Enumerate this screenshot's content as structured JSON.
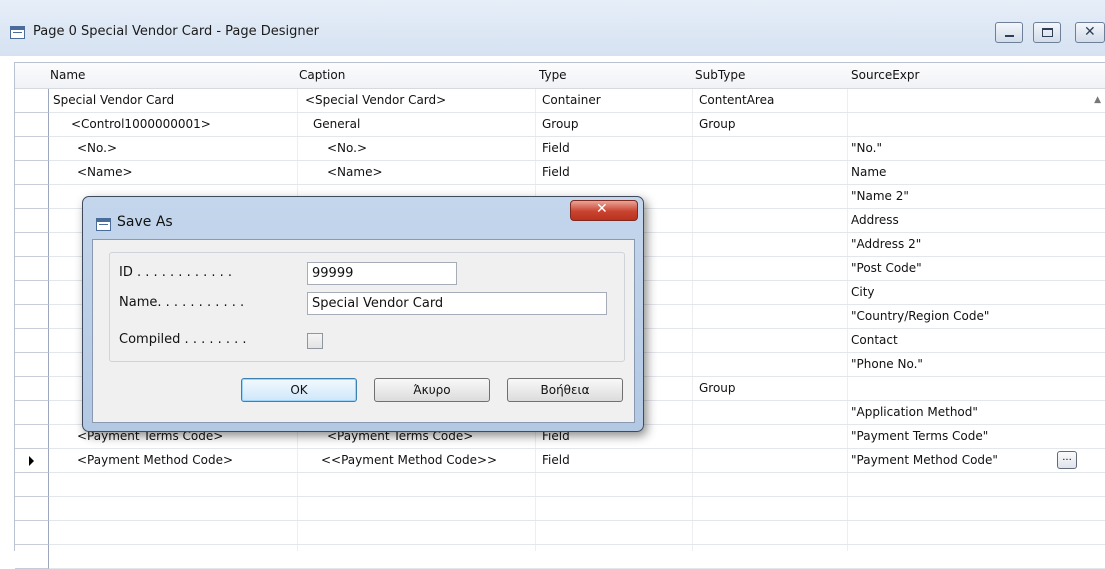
{
  "window": {
    "title": "Page 0 Special Vendor Card - Page Designer"
  },
  "grid": {
    "columns": [
      "Name",
      "Caption",
      "Type",
      "SubType",
      "SourceExpr"
    ],
    "rows": [
      {
        "name": "Special Vendor Card",
        "caption": "<Special Vendor Card>",
        "type": "Container",
        "subtype": "ContentArea",
        "source": ""
      },
      {
        "name": "<Control1000000001>",
        "caption": "General",
        "type": "Group",
        "subtype": "Group",
        "source": ""
      },
      {
        "name": "<No.>",
        "caption": "<No.>",
        "type": "Field",
        "subtype": "",
        "source": "\"No.\""
      },
      {
        "name": "<Name>",
        "caption": "<Name>",
        "type": "Field",
        "subtype": "",
        "source": "Name"
      },
      {
        "name": "",
        "caption": "",
        "type": "",
        "subtype": "",
        "source": "\"Name 2\""
      },
      {
        "name": "",
        "caption": "",
        "type": "",
        "subtype": "",
        "source": "Address"
      },
      {
        "name": "",
        "caption": "",
        "type": "",
        "subtype": "",
        "source": "\"Address 2\""
      },
      {
        "name": "",
        "caption": "",
        "type": "",
        "subtype": "",
        "source": "\"Post Code\""
      },
      {
        "name": "",
        "caption": "",
        "type": "",
        "subtype": "",
        "source": "City"
      },
      {
        "name": "",
        "caption": "",
        "type": "",
        "subtype": "",
        "source": "\"Country/Region Code\""
      },
      {
        "name": "",
        "caption": "",
        "type": "",
        "subtype": "",
        "source": "Contact"
      },
      {
        "name": "",
        "caption": "",
        "type": "",
        "subtype": "",
        "source": "\"Phone No.\""
      },
      {
        "name": "",
        "caption": "",
        "type": "",
        "subtype": "Group",
        "source": ""
      },
      {
        "name": "",
        "caption": "",
        "type": "",
        "subtype": "",
        "source": "\"Application Method\""
      },
      {
        "name": "<Payment Terms Code>",
        "caption": "<Payment Terms Code>",
        "type": "Field",
        "subtype": "",
        "source": "\"Payment Terms Code\""
      },
      {
        "name": "<Payment Method Code>",
        "caption": "<<Payment Method Code>>",
        "type": "Field",
        "subtype": "",
        "source": "\"Payment Method Code\""
      }
    ]
  },
  "dialog": {
    "title": "Save As",
    "fields": {
      "id_label": "ID . . . . . . . . . . . .",
      "id_value": "99999",
      "name_label": "Name. . . . . . . . . . .",
      "name_value": "Special Vendor Card",
      "compiled_label": "Compiled . . . . . . . ."
    },
    "buttons": {
      "ok": "OK",
      "cancel": "Άκυρο",
      "help": "Βοήθεια"
    }
  }
}
